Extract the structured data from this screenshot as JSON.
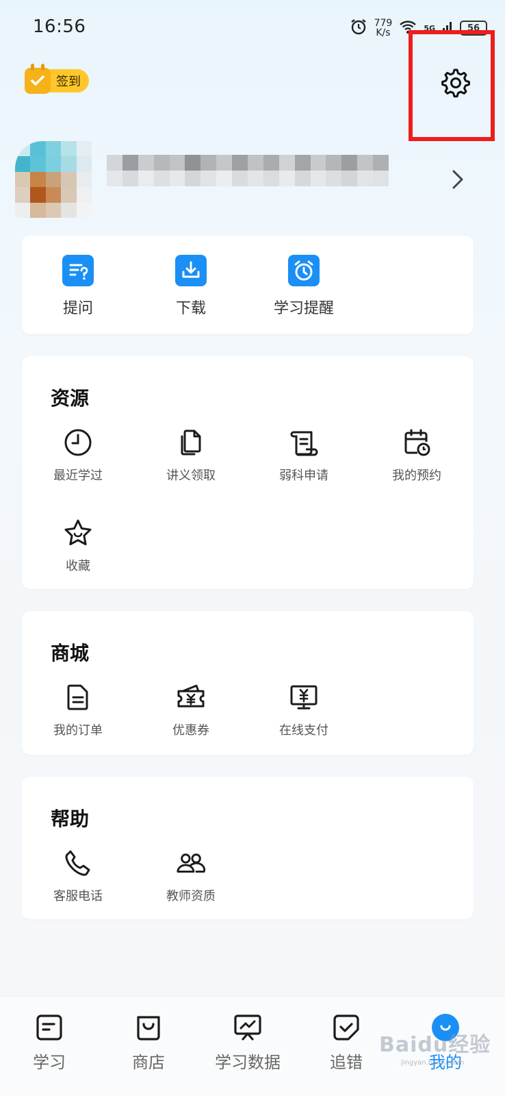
{
  "status_bar": {
    "time": "16:56",
    "speed_value": "779",
    "speed_unit": "K/s",
    "network": "5G",
    "battery": "56"
  },
  "header": {
    "signin_label": "签到"
  },
  "quick_actions": [
    {
      "label": "提问",
      "icon": "question-icon"
    },
    {
      "label": "下载",
      "icon": "download-icon"
    },
    {
      "label": "学习提醒",
      "icon": "alarm-clock-icon"
    }
  ],
  "resources": {
    "title": "资源",
    "items": [
      {
        "label": "最近学过",
        "icon": "clock-icon"
      },
      {
        "label": "讲义领取",
        "icon": "documents-icon"
      },
      {
        "label": "弱科申请",
        "icon": "scroll-icon"
      },
      {
        "label": "我的预约",
        "icon": "calendar-clock-icon"
      },
      {
        "label": "收藏",
        "icon": "star-icon"
      }
    ]
  },
  "mall": {
    "title": "商城",
    "items": [
      {
        "label": "我的订单",
        "icon": "order-icon"
      },
      {
        "label": "优惠券",
        "icon": "coupon-icon"
      },
      {
        "label": "在线支付",
        "icon": "online-payment-icon"
      }
    ]
  },
  "help": {
    "title": "帮助",
    "items": [
      {
        "label": "客服电话",
        "icon": "phone-icon"
      },
      {
        "label": "教师资质",
        "icon": "teachers-icon"
      }
    ]
  },
  "bottom_nav": [
    {
      "label": "学习",
      "icon": "study-icon"
    },
    {
      "label": "商店",
      "icon": "shop-bag-icon"
    },
    {
      "label": "学习数据",
      "icon": "data-chart-icon"
    },
    {
      "label": "追错",
      "icon": "check-mistakes-icon"
    },
    {
      "label": "我的",
      "icon": "me-icon",
      "active": true
    }
  ],
  "watermark": {
    "text": "Baidu经验",
    "sub": "jingyan.baidu.com"
  },
  "colors": {
    "accent": "#1a8ff5",
    "signin": "#ffc72c",
    "highlight": "#ef1d1d"
  }
}
